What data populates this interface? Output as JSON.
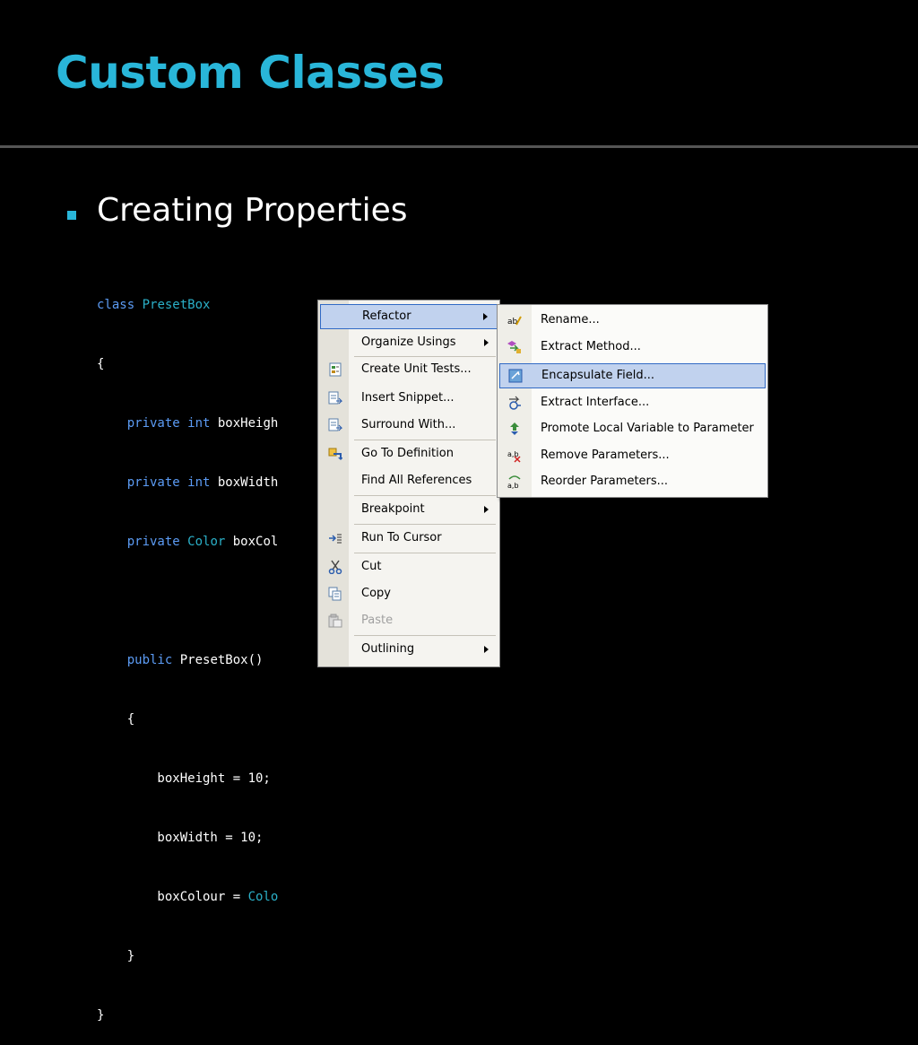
{
  "slide": {
    "title": "Custom Classes",
    "bullet": "Creating Properties"
  },
  "colors": {
    "accent": "#29b6d9",
    "keyword": "#5c9cf5",
    "type": "#2bb0c8",
    "menu_highlight": "#c1d2ee"
  },
  "code": [
    {
      "a": "class",
      "b": " ",
      "c": "PresetBox",
      "d": ""
    },
    {
      "a": "{",
      "b": "",
      "c": "",
      "d": ""
    },
    {
      "a": "    private int",
      "b": " boxHeigh",
      "c": "",
      "d": ""
    },
    {
      "a": "    private int",
      "b": " boxWidth",
      "c": "",
      "d": ""
    },
    {
      "a": "    private ",
      "b": "",
      "c": "Color",
      "d": " boxCol"
    },
    {
      "a": "",
      "b": "",
      "c": "",
      "d": ""
    },
    {
      "a": "    public",
      "b": " PresetBox()",
      "c": "",
      "d": ""
    },
    {
      "a": "    {",
      "b": "",
      "c": "",
      "d": ""
    },
    {
      "a": "        boxHeight = 10;",
      "b": "",
      "c": "",
      "d": ""
    },
    {
      "a": "        boxWidth = 10;",
      "b": "",
      "c": "",
      "d": ""
    },
    {
      "a": "        boxColour = ",
      "b": "",
      "c": "Colo",
      "d": ""
    },
    {
      "a": "    }",
      "b": "",
      "c": "",
      "d": ""
    },
    {
      "a": "}",
      "b": "",
      "c": "",
      "d": ""
    }
  ],
  "context_menu": {
    "items": [
      {
        "label": "Refactor",
        "icon": "none",
        "submenu": true,
        "highlighted": true
      },
      {
        "label": "Organize Usings",
        "icon": "none",
        "submenu": true
      },
      {
        "label": "Create Unit Tests...",
        "icon": "unit-test-icon"
      },
      {
        "label": "Insert Snippet...",
        "icon": "insert-snippet-icon"
      },
      {
        "label": "Surround With...",
        "icon": "surround-with-icon"
      },
      {
        "label": "Go To Definition",
        "icon": "go-to-definition-icon"
      },
      {
        "label": "Find All References",
        "icon": "none"
      },
      {
        "label": "Breakpoint",
        "icon": "none",
        "submenu": true
      },
      {
        "label": "Run To Cursor",
        "icon": "run-to-cursor-icon"
      },
      {
        "label": "Cut",
        "icon": "scissors-icon"
      },
      {
        "label": "Copy",
        "icon": "copy-icon"
      },
      {
        "label": "Paste",
        "icon": "paste-icon",
        "disabled": true
      },
      {
        "label": "Outlining",
        "icon": "none",
        "submenu": true
      }
    ]
  },
  "refactor_submenu": {
    "items": [
      {
        "label": "Rename...",
        "icon": "rename-icon"
      },
      {
        "label": "Extract Method...",
        "icon": "extract-method-icon"
      },
      {
        "label": "Encapsulate Field...",
        "icon": "encapsulate-field-icon",
        "highlighted": true
      },
      {
        "label": "Extract Interface...",
        "icon": "extract-interface-icon"
      },
      {
        "label": "Promote Local Variable to Parameter",
        "icon": "promote-variable-icon"
      },
      {
        "label": "Remove Parameters...",
        "icon": "remove-parameters-icon"
      },
      {
        "label": "Reorder Parameters...",
        "icon": "reorder-parameters-icon"
      }
    ]
  }
}
